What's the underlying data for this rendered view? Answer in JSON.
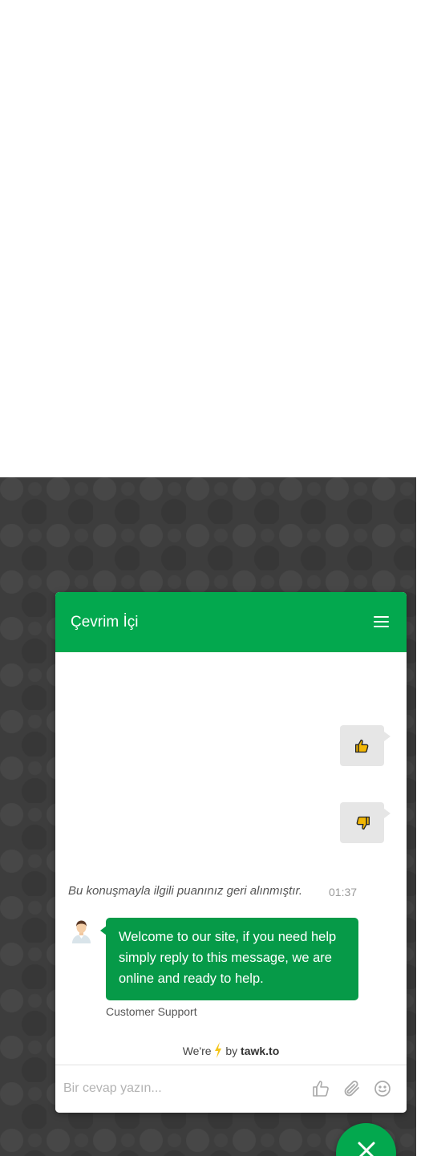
{
  "chat": {
    "title": "Çevrim İçi",
    "rating_notice": "Bu konuşmayla ilgili puanınız geri alınmıştır.",
    "rating_time": "01:37",
    "agent_message": "Welcome to our site, if you need help simply reply to this message, we are online and ready to help.",
    "agent_name": "Customer Support",
    "branding": {
      "prefix": "We're",
      "by": "by",
      "brand": "tawk.to"
    },
    "input": {
      "placeholder": "Bir cevap yazın..."
    }
  },
  "colors": {
    "brand_green": "#03a84e",
    "bubble_green": "#069a48",
    "overlay": "#3d3d3d",
    "bolt": "#f5c518"
  },
  "icons": [
    "menu-icon",
    "thumbs-up-icon",
    "thumbs-down-icon",
    "agent-avatar",
    "lightning-icon",
    "attachment-icon",
    "emoji-icon",
    "close-icon"
  ]
}
